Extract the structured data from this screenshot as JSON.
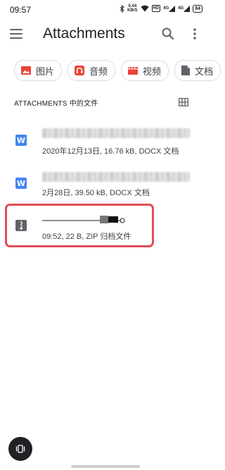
{
  "status_bar": {
    "time": "09:57",
    "net_speed_value": "0.44",
    "net_speed_unit": "KB/S",
    "hd_label": "HD",
    "signal1_label": "4G",
    "signal2_label": "4G",
    "battery": "84"
  },
  "app_bar": {
    "title": "Attachments",
    "menu_icon": "menu-icon",
    "search_icon": "search-icon",
    "more_icon": "more-vert-icon"
  },
  "chips": [
    {
      "label": "图片",
      "icon": "image-icon",
      "color": "#ea4335"
    },
    {
      "label": "音频",
      "icon": "audio-icon",
      "color": "#ea4335"
    },
    {
      "label": "视频",
      "icon": "video-icon",
      "color": "#ea4335"
    },
    {
      "label": "文档",
      "icon": "document-icon",
      "color": "#5f6368"
    }
  ],
  "section": {
    "title": "ATTACHMENTS 中的文件",
    "view_toggle_icon": "grid-view-icon"
  },
  "files": [
    {
      "icon": "word-doc-icon",
      "icon_letter": "W",
      "meta": "2020年12月13日, 16.76 kB, DOCX 文档"
    },
    {
      "icon": "word-doc-icon",
      "icon_letter": "W",
      "meta": "2月28日, 39.50 kB, DOCX 文档"
    },
    {
      "icon": "zip-archive-icon",
      "meta": "09:52, 22 B, ZIP 归档文件"
    }
  ],
  "colors": {
    "accent_red": "#ea4335",
    "word_blue": "#4285f4",
    "highlight": "#e04e57"
  }
}
